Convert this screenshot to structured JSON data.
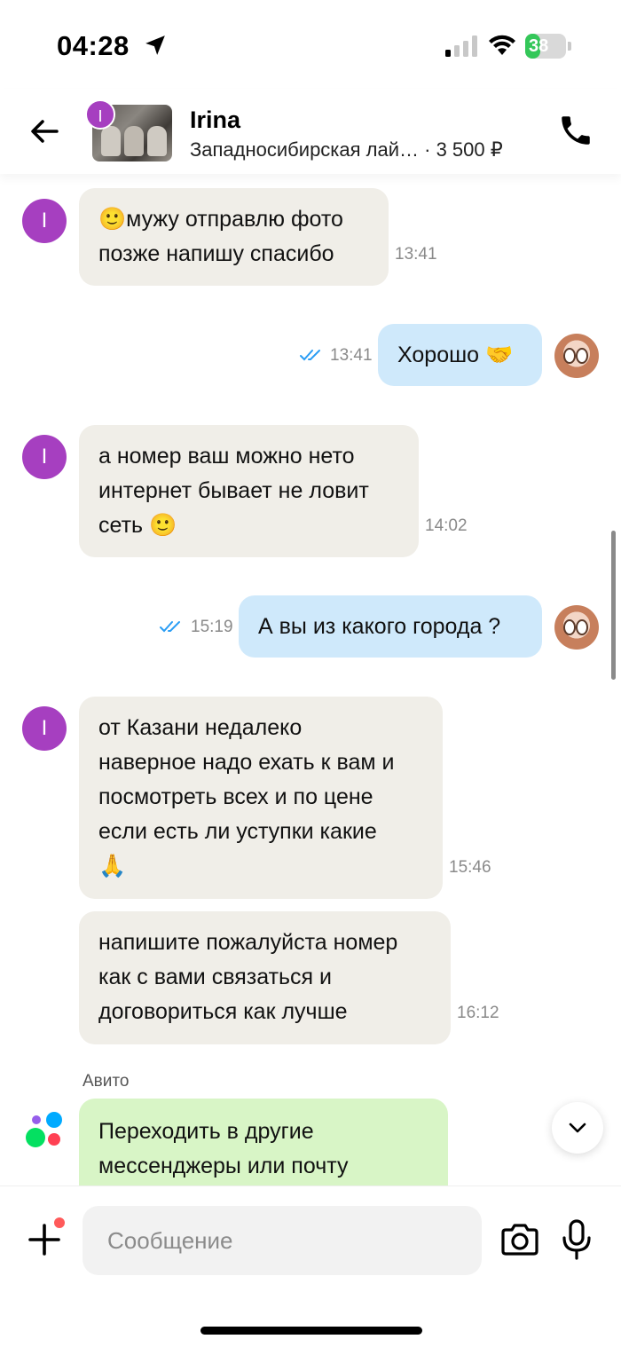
{
  "status_bar": {
    "time": "04:28",
    "battery": "38",
    "battery_level": 0.38
  },
  "header": {
    "avatar_initial": "I",
    "contact_name": "Irina",
    "listing_title": "Западносибирская лай… · 3 500 ₽"
  },
  "messages": [
    {
      "direction": "in",
      "initial": "I",
      "text": "🙂мужу отправлю фото\nпозже напишу спасибо",
      "time": "13:41"
    },
    {
      "direction": "out",
      "text": "Хорошо 🤝",
      "time": "13:41",
      "read": true
    },
    {
      "direction": "in",
      "initial": "I",
      "text": "а номер ваш можно нето\nинтернет бывает не ловит\nсеть 🙂",
      "time": "14:02"
    },
    {
      "direction": "out",
      "text": "А вы из какого города ?",
      "time": "15:19",
      "read": true
    },
    {
      "direction": "in",
      "initial": "I",
      "text": "от Казани недалеко\nнаверное надо ехать к вам и\nпосмотреть всех  и по цене\nесли есть ли уступки какие\n🙏",
      "time": "15:46"
    },
    {
      "direction": "in",
      "text": "напишите пожалуйста номер\nкак с вами связаться и\nдоговориться как лучше",
      "time": "16:12"
    }
  ],
  "system_message": {
    "sender": "Авито",
    "text": "Переходить в другие\nмессенджеры или почту"
  },
  "composer": {
    "placeholder": "Сообщение"
  },
  "icons": {
    "back": "back-arrow-icon",
    "call": "phone-icon",
    "plus": "plus-icon",
    "camera": "camera-icon",
    "mic": "microphone-icon",
    "scroll_down": "chevron-down-icon"
  },
  "colors": {
    "incoming_bubble": "#f0eee8",
    "outgoing_bubble": "#cfe9fb",
    "system_bubble": "#d8f5c6",
    "avatar_purple": "#a63fc0",
    "read_ticks": "#2a9df4"
  }
}
